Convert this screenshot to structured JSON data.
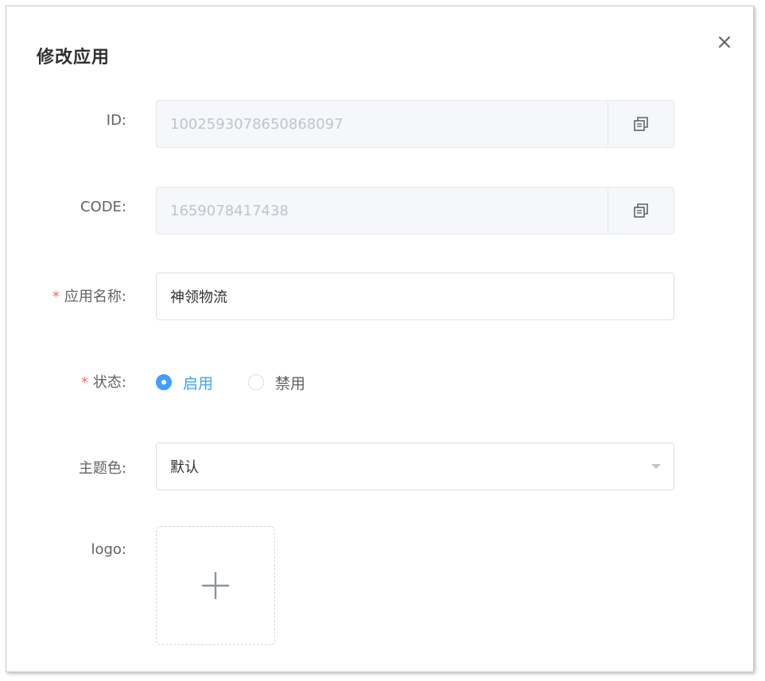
{
  "dialog": {
    "title": "修改应用"
  },
  "form": {
    "id": {
      "label": "ID:",
      "value": "1002593078650868097"
    },
    "code": {
      "label": "CODE:",
      "value": "1659078417438"
    },
    "app_name": {
      "required": "*",
      "label": "应用名称:",
      "value": "神领物流"
    },
    "status": {
      "required": "*",
      "label": "状态:",
      "options": [
        "启用",
        "禁用"
      ],
      "selected": "启用"
    },
    "theme": {
      "label": "主题色:",
      "value": "默认"
    },
    "logo": {
      "label": "logo:"
    }
  },
  "icons": {
    "close": "close-icon",
    "copy": "copy-icon",
    "dropdown": "caret-down-icon",
    "upload": "plus-icon"
  },
  "colors": {
    "primary": "#409eff",
    "required": "#f56c6c",
    "text": "#303133",
    "label": "#606266",
    "placeholder": "#c0c4cc"
  }
}
